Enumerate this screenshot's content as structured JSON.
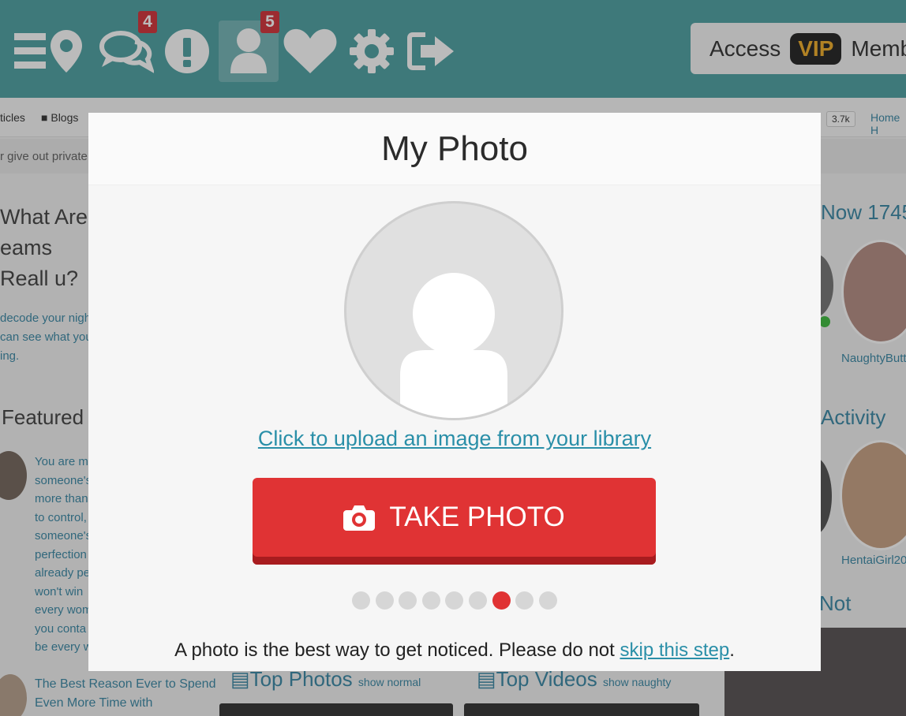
{
  "topbar": {
    "badges": {
      "messages": "4",
      "profile": "5"
    },
    "vip": {
      "prefix": "Access",
      "tag": "VIP",
      "suffix": "Membe"
    },
    "icons": [
      "menu-icon",
      "map-pin-icon",
      "chat-icon",
      "alert-icon",
      "user-icon",
      "heart-icon",
      "gear-icon",
      "logout-icon"
    ]
  },
  "subnav": {
    "articles": "ticles",
    "blogs": "Blogs",
    "count": "3.7k",
    "home": "Home H"
  },
  "warning": {
    "text": "r give out private"
  },
  "left": {
    "article_title": "What Are eams Reall u?",
    "article_desc": "decode your night can see what you ing.",
    "featured_heading": "Featured",
    "featured_text": "You are m someone's more than to control, someone's perfection already pe won't win every wom you conta be every w",
    "featured2_text": "The Best Reason Ever to Spend Even More Time with"
  },
  "bottom": {
    "photos_heading": "Top Photos",
    "photos_sub": "show normal",
    "videos_heading": "Top Videos",
    "videos_sub": "show naughty"
  },
  "right": {
    "online_heading": "Now 1745",
    "user1": "NaughtyButt",
    "activity_heading": "Activity",
    "user2": "HentaiGirl20",
    "hot_heading": "Not"
  },
  "modal": {
    "title": "My Photo",
    "upload_link": "Click to upload an image from your library",
    "take_photo": "TAKE PHOTO",
    "notice_text": "A photo is the best way to get noticed. Please do not ",
    "skip_link": "skip this step",
    "notice_end": ".",
    "progress": {
      "total_steps": 9,
      "current_step": 7
    }
  },
  "colors": {
    "teal": "#3f9a9b",
    "red": "#e03334",
    "link": "#2a8fa8"
  }
}
